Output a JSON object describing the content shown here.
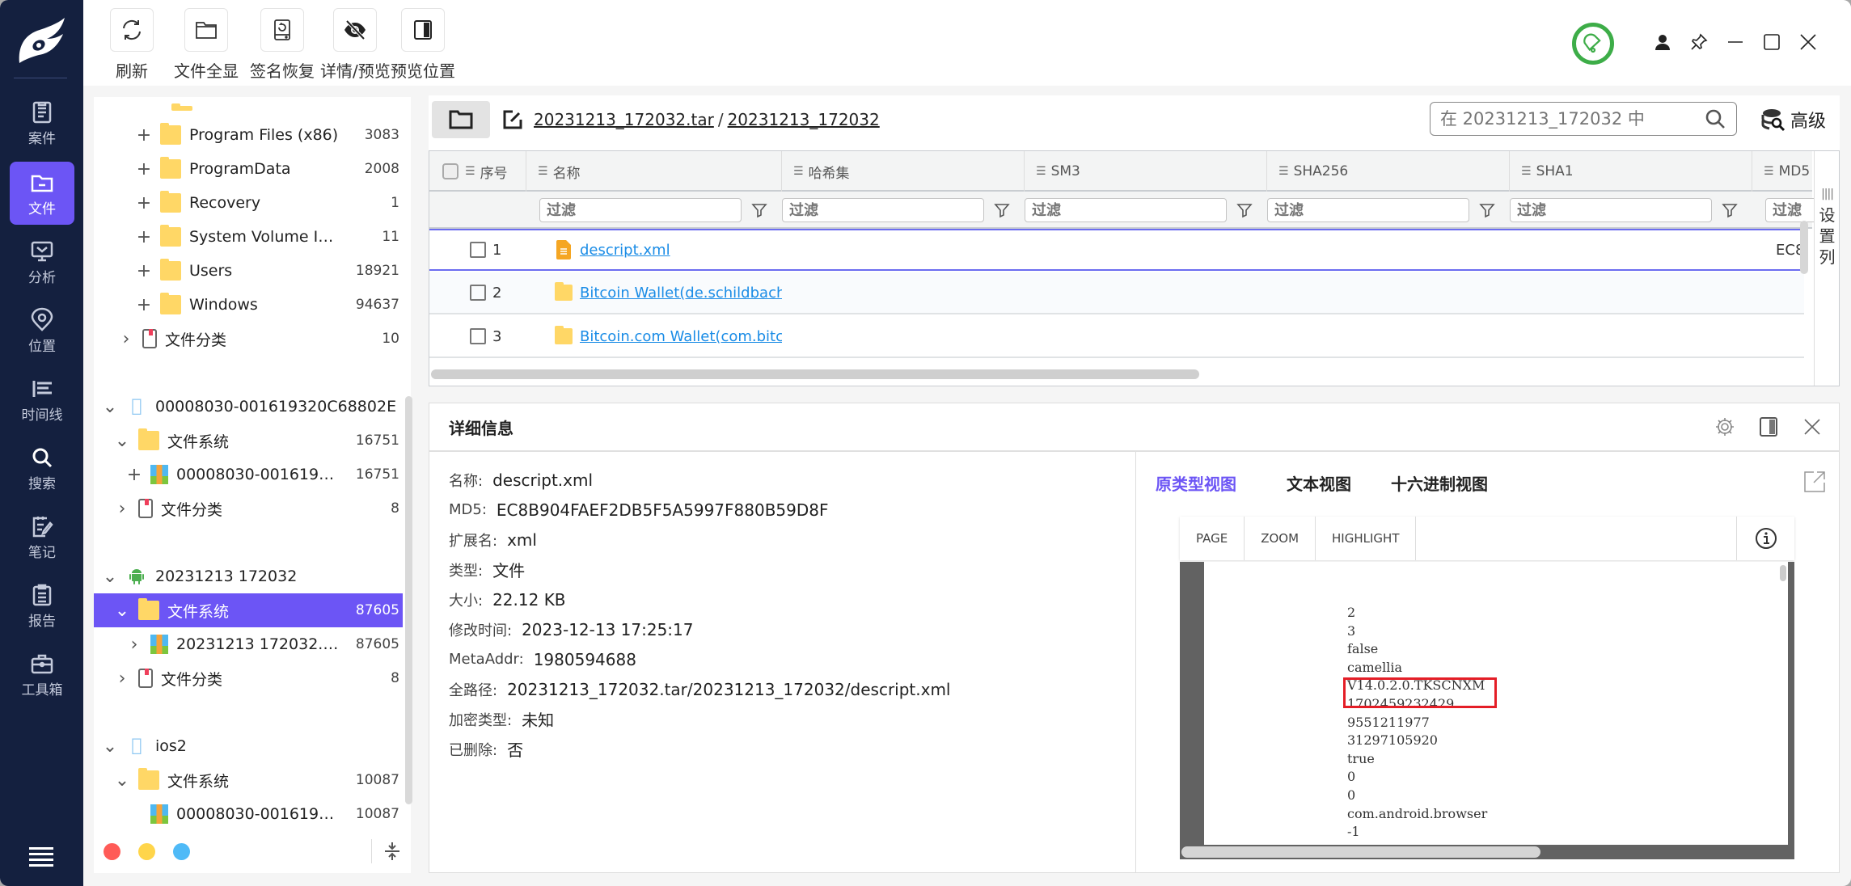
{
  "nav": {
    "items": [
      {
        "label": "案件",
        "icon": "case-icon"
      },
      {
        "label": "文件",
        "icon": "folder-icon",
        "active": true
      },
      {
        "label": "分析",
        "icon": "analysis-icon"
      },
      {
        "label": "位置",
        "icon": "location-icon"
      },
      {
        "label": "时间线",
        "icon": "timeline-icon"
      },
      {
        "label": "搜索",
        "icon": "search-icon"
      },
      {
        "label": "笔记",
        "icon": "notes-icon"
      },
      {
        "label": "报告",
        "icon": "report-icon"
      },
      {
        "label": "工具箱",
        "icon": "toolbox-icon"
      }
    ]
  },
  "toolbar": {
    "refresh": "刷新",
    "show_all": "文件全显",
    "signature_recovery": "签名恢复",
    "detail_preview": "详情/预览",
    "preview_position": "预览位置"
  },
  "tree": {
    "rows": [
      {
        "label": "Program Files (x86)",
        "count": "3083",
        "expander": "+",
        "icon": "folder"
      },
      {
        "label": "ProgramData",
        "count": "2008",
        "expander": "+",
        "icon": "folder"
      },
      {
        "label": "Recovery",
        "count": "1",
        "expander": "+",
        "icon": "folder"
      },
      {
        "label": "System Volume Info...",
        "count": "11",
        "expander": "+",
        "icon": "folder"
      },
      {
        "label": "Users",
        "count": "18921",
        "expander": "+",
        "icon": "folder"
      },
      {
        "label": "Windows",
        "count": "94637",
        "expander": "+",
        "icon": "folder"
      },
      {
        "label": "文件分类",
        "count": "10",
        "expander": "›",
        "icon": "doc"
      },
      {
        "label": "00008030-001619320C68802E",
        "count": "",
        "expander": "⌄",
        "icon": "apple"
      },
      {
        "label": "文件系统",
        "count": "16751",
        "expander": "⌄",
        "icon": "folder"
      },
      {
        "label": "00008030-00161932...",
        "count": "16751",
        "expander": "+",
        "icon": "zip"
      },
      {
        "label": "文件分类",
        "count": "8",
        "expander": "›",
        "icon": "doc"
      },
      {
        "label": "20231213 172032",
        "count": "",
        "expander": "⌄",
        "icon": "android"
      },
      {
        "label": "文件系统",
        "count": "87605",
        "expander": "⌄",
        "icon": "folder",
        "selected": true
      },
      {
        "label": "20231213 172032.tar",
        "count": "87605",
        "expander": "›",
        "icon": "zip"
      },
      {
        "label": "文件分类",
        "count": "8",
        "expander": "›",
        "icon": "doc"
      },
      {
        "label": "ios2",
        "count": "",
        "expander": "⌄",
        "icon": "apple"
      },
      {
        "label": "文件系统",
        "count": "10087",
        "expander": "⌄",
        "icon": "folder"
      },
      {
        "label": "00008030-00161932...",
        "count": "10087",
        "expander": "",
        "icon": "zip"
      }
    ],
    "tag_colors": [
      "#ff5b57",
      "#ffd54a",
      "#4fbaf7"
    ]
  },
  "pathbar": {
    "crumbs": [
      "20231213_172032.tar",
      "20231213_172032"
    ],
    "separator": "/",
    "search_placeholder": "在 20231213_172032 中",
    "advanced": "高级"
  },
  "grid": {
    "columns": [
      "序号",
      "名称",
      "哈希集",
      "SM3",
      "SHA256",
      "SHA1",
      "MD5"
    ],
    "filter_placeholder": "过滤",
    "settings_label": [
      "设",
      "置",
      "列"
    ],
    "rows": [
      {
        "index": "1",
        "name": "descript.xml",
        "type": "xml",
        "md5": "EC8"
      },
      {
        "index": "2",
        "name": "Bitcoin Wallet(de.schildbach",
        "type": "folder",
        "md5": ""
      },
      {
        "index": "3",
        "name": "Bitcoin.com Wallet(com.bitc",
        "type": "folder",
        "md5": ""
      }
    ]
  },
  "detail": {
    "title": "详细信息",
    "props": [
      {
        "k": "名称:",
        "v": "descript.xml"
      },
      {
        "k": "MD5:",
        "v": "EC8B904FAEF2DB5F5A5997F880B59D8F"
      },
      {
        "k": "扩展名:",
        "v": "xml"
      },
      {
        "k": "类型:",
        "v": "文件"
      },
      {
        "k": "大小:",
        "v": "22.12 KB"
      },
      {
        "k": "修改时间:",
        "v": "2023-12-13 17:25:17"
      },
      {
        "k": "MetaAddr:",
        "v": "1980594688"
      },
      {
        "k": "全路径:",
        "v": "20231213_172032.tar/20231213_172032/descript.xml"
      },
      {
        "k": "加密类型:",
        "v": "未知"
      },
      {
        "k": "已删除:",
        "v": "否"
      }
    ],
    "tabs": [
      "原类型视图",
      "文本视图",
      "十六进制视图"
    ],
    "pdf_toolbar": [
      "PAGE",
      "ZOOM",
      "HIGHLIGHT"
    ],
    "content_lines": [
      "2",
      "3",
      "false",
      "camellia",
      "V14.0.2.0.TKSCNXM",
      "1702459232429",
      "9551211977",
      "31297105920",
      "true",
      "0",
      "0",
      "com.android.browser",
      "-1"
    ],
    "highlighted": "V14.0.2.0.TKSCNXM"
  },
  "colors": {
    "accent": "#6c55f5",
    "nav_bg": "#14203f",
    "link": "#1a8ce6",
    "highlight_box": "#e41e27",
    "notify": "#3dad48"
  }
}
